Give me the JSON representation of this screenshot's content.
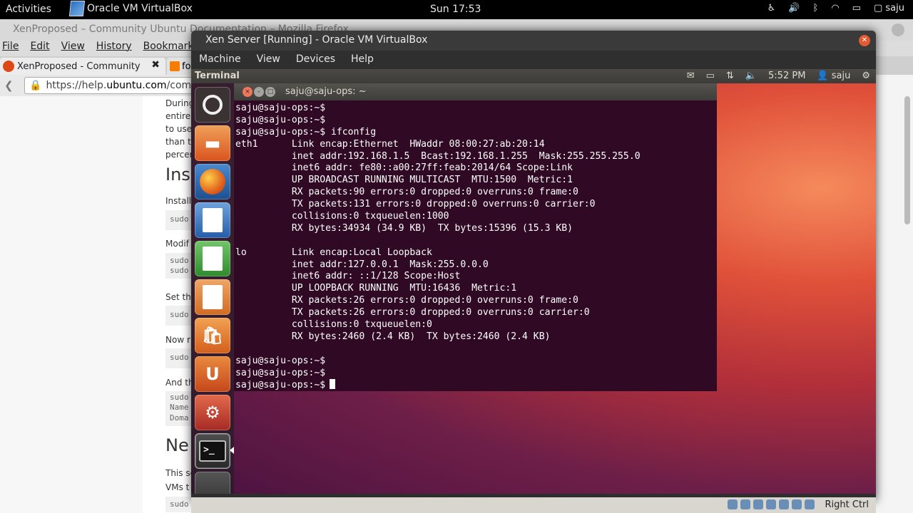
{
  "topbar": {
    "activities": "Activities",
    "app_name": "Oracle VM VirtualBox",
    "clock": "Sun 17:53",
    "user": "saju"
  },
  "firefox": {
    "window_title": "XenProposed – Community Ubuntu Documentation – Mozilla Firefox",
    "menu": [
      "File",
      "Edit",
      "View",
      "History",
      "Bookmarks"
    ],
    "tab1_label": "XenProposed - Community",
    "tab2_label": "fo",
    "url_prefix": "https://help.",
    "url_domain": "ubuntu.com",
    "url_suffix": "/commu",
    "page_fragments": {
      "p1": "During",
      "p2": "entire",
      "p3": "to use",
      "p4": "than t",
      "p5": "percen",
      "h1": "Ins",
      "p6": "Install",
      "c1": "sudo",
      "p7": "Modif",
      "c2a": "sudo",
      "c2b": "sudo",
      "p8": "Set th",
      "c3": "sudo",
      "p9": "Now r",
      "c4": "sudo",
      "p10": "And th",
      "c5a": "sudo",
      "c5b": "Name",
      "c5c": "Doma",
      "h2": "Ne",
      "p11": "This se",
      "p12": "VMs t",
      "c6": "sudo"
    }
  },
  "vbox": {
    "title": "Xen Server [Running] - Oracle VM VirtualBox",
    "menu": [
      "Machine",
      "View",
      "Devices",
      "Help"
    ],
    "host_key": "Right Ctrl"
  },
  "guest": {
    "panel_app": "Terminal",
    "time": "5:52 PM",
    "user": "saju",
    "terminal_title": "saju@saju-ops: ~",
    "prompt": "saju@saju-ops:~$",
    "lines": [
      "saju@saju-ops:~$",
      "saju@saju-ops:~$",
      "saju@saju-ops:~$ ifconfig",
      "eth1      Link encap:Ethernet  HWaddr 08:00:27:ab:20:14",
      "          inet addr:192.168.1.5  Bcast:192.168.1.255  Mask:255.255.255.0",
      "          inet6 addr: fe80::a00:27ff:feab:2014/64 Scope:Link",
      "          UP BROADCAST RUNNING MULTICAST  MTU:1500  Metric:1",
      "          RX packets:90 errors:0 dropped:0 overruns:0 frame:0",
      "          TX packets:131 errors:0 dropped:0 overruns:0 carrier:0",
      "          collisions:0 txqueuelen:1000",
      "          RX bytes:34934 (34.9 KB)  TX bytes:15396 (15.3 KB)",
      "",
      "lo        Link encap:Local Loopback",
      "          inet addr:127.0.0.1  Mask:255.0.0.0",
      "          inet6 addr: ::1/128 Scope:Host",
      "          UP LOOPBACK RUNNING  MTU:16436  Metric:1",
      "          RX packets:26 errors:0 dropped:0 overruns:0 frame:0",
      "          TX packets:26 errors:0 dropped:0 overruns:0 carrier:0",
      "          collisions:0 txqueuelen:0",
      "          RX bytes:2460 (2.4 KB)  TX bytes:2460 (2.4 KB)",
      "",
      "saju@saju-ops:~$",
      "saju@saju-ops:~$",
      "saju@saju-ops:~$"
    ]
  },
  "colors": {
    "terminal_bg": "#300a24",
    "ubuntu_orange": "#dd4814",
    "vbox_close": "#e25a32"
  }
}
